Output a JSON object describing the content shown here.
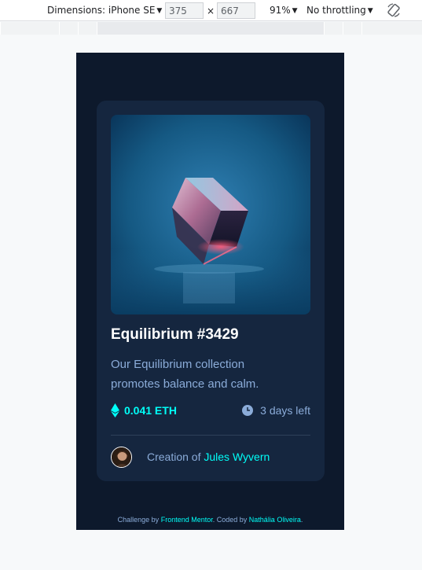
{
  "devtools": {
    "dimensions_label": "Dimensions: iPhone SE",
    "width_value": "375",
    "times": "×",
    "height_value": "667",
    "zoom": "91%",
    "throttling": "No throttling",
    "rotate_icon": "rotate-icon"
  },
  "card": {
    "title": "Equilibrium #3429",
    "description": "Our Equilibrium collection promotes balance and calm.",
    "price": "0.041 ETH",
    "time_left": "3 days left",
    "creator_prefix": "Creation of",
    "creator_name": "Jules Wyvern",
    "icons": [
      "ethereum-icon",
      "clock-icon"
    ],
    "image_subject": "cube"
  },
  "attribution": {
    "prefix": "Challenge by",
    "challenge_link": "Frontend Mentor",
    "middle": ". Coded by",
    "author_link": "Nathália Oliveira",
    "suffix": "."
  },
  "colors": {
    "page_bg": "#0d192c",
    "card_bg": "#15263f",
    "accent": "#00fff8",
    "muted_text": "#8bacd9",
    "line": "#2e405a"
  }
}
